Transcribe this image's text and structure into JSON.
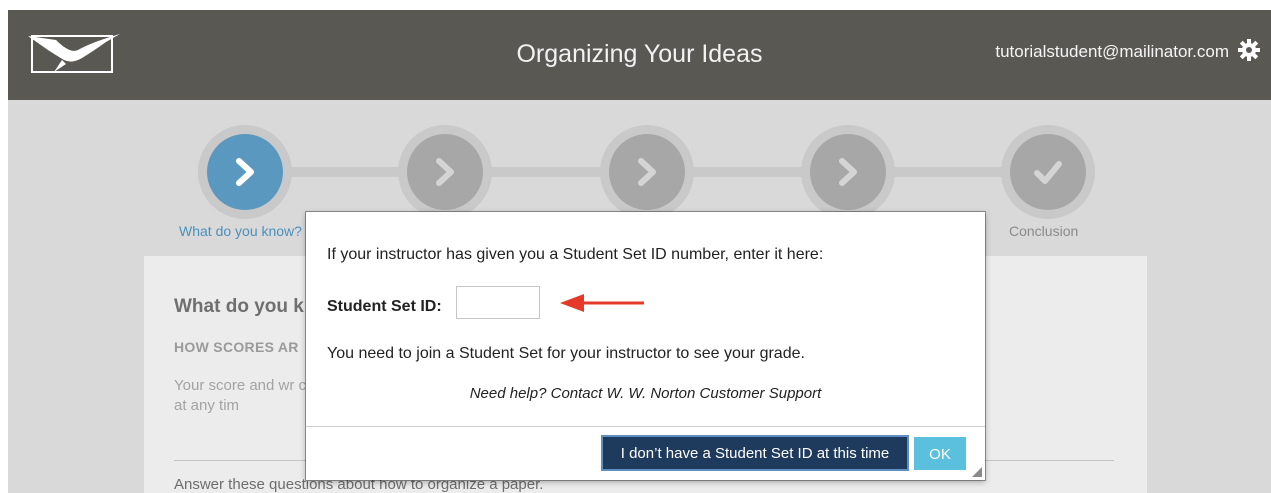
{
  "header": {
    "title": "Organizing Your Ideas",
    "user_email": "tutorialstudent@mailinator.com",
    "logo_icon": "seagull-logo-icon",
    "settings_icon": "gear-icon"
  },
  "stepper": {
    "steps": [
      {
        "label": "What do you know?",
        "state": "current",
        "icon": "chevron-right-icon"
      },
      {
        "label": "",
        "state": "locked",
        "icon": "chevron-right-icon"
      },
      {
        "label": "",
        "state": "locked",
        "icon": "chevron-right-icon"
      },
      {
        "label": "",
        "state": "locked",
        "icon": "chevron-right-icon"
      },
      {
        "label": "Conclusion",
        "state": "locked",
        "icon": "checkmark-icon"
      }
    ]
  },
  "content": {
    "heading": "What do you k",
    "subheading": "HOW SCORES AR",
    "paragraph": "Your score and wr complete all tasks tutorial at any tim",
    "question": "Answer these questions about how to organize a paper."
  },
  "modal": {
    "prompt": "If your instructor has given you a Student Set ID number, enter it here:",
    "field_label": "Student Set ID:",
    "field_value": "",
    "field_placeholder": "",
    "note": "You need to join a Student Set for your instructor to see your grade.",
    "help": "Need help? Contact W. W. Norton Customer Support",
    "no_id_button": "I don’t have a Student Set ID at this time",
    "ok_button": "OK"
  },
  "colors": {
    "header_bg": "#595852",
    "active_step": "#5b98c0",
    "primary_button": "#1e3a5c",
    "ok_button": "#5bc0de",
    "annotation_arrow": "#e53a2a"
  }
}
